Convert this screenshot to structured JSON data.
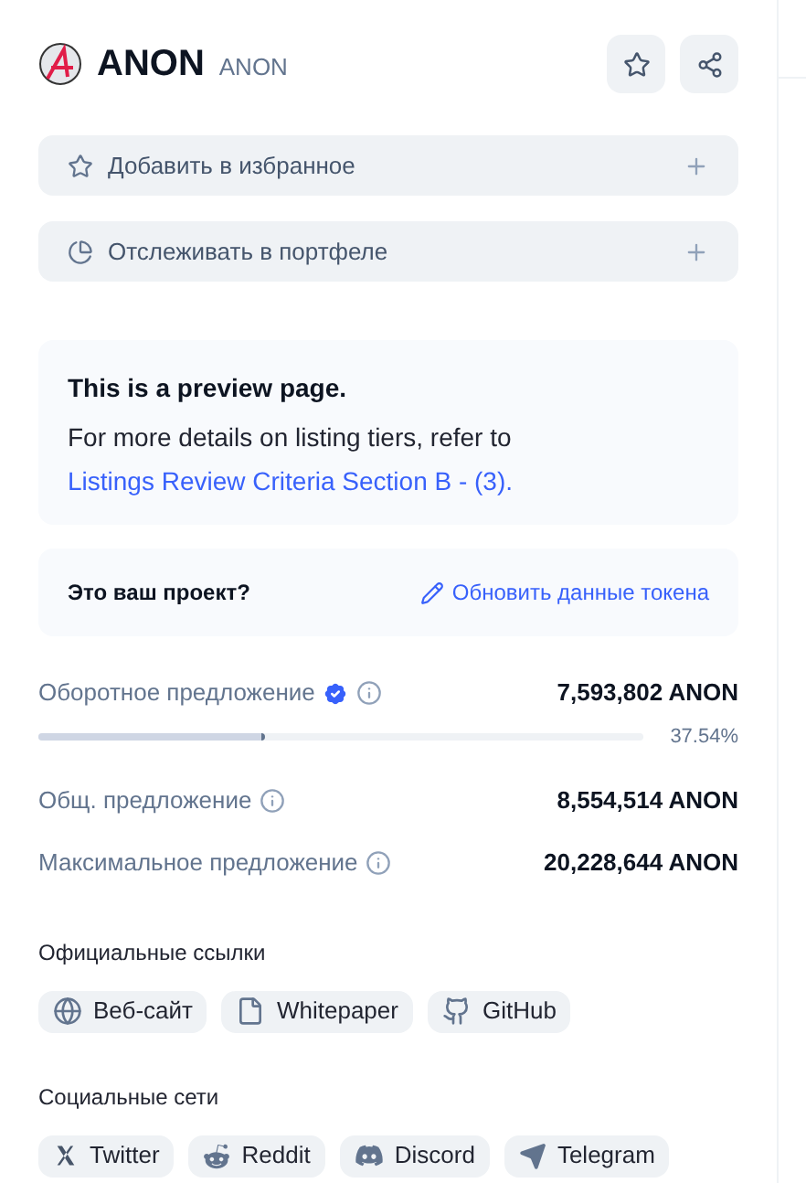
{
  "header": {
    "name": "ANON",
    "symbol": "ANON"
  },
  "actions": [
    {
      "label": "Добавить в избранное"
    },
    {
      "label": "Отслеживать в портфеле"
    }
  ],
  "notice": {
    "title": "This is a preview page.",
    "text": "For more details on listing tiers, refer to",
    "link": "Listings Review Criteria Section B - (3)."
  },
  "project": {
    "question": "Это ваш проект?",
    "link": "Обновить данные токена"
  },
  "stats": [
    {
      "label": "Оборотное предложение",
      "verified": true,
      "value": "7,593,802 ANON",
      "level": 0.3754,
      "reading": "37.54%"
    },
    {
      "label": "Общ. предложение",
      "verified": false,
      "value": "8,554,514 ANON"
    },
    {
      "label": "Максимальное предложение",
      "verified": false,
      "value": "20,228,644 ANON"
    }
  ],
  "official_links": {
    "title": "Официальные ссылки",
    "items": [
      "Веб-сайт",
      "Whitepaper",
      "GitHub"
    ]
  },
  "socials": {
    "title": "Социальные сети",
    "items": [
      "Twitter",
      "Reddit",
      "Discord",
      "Telegram"
    ]
  }
}
